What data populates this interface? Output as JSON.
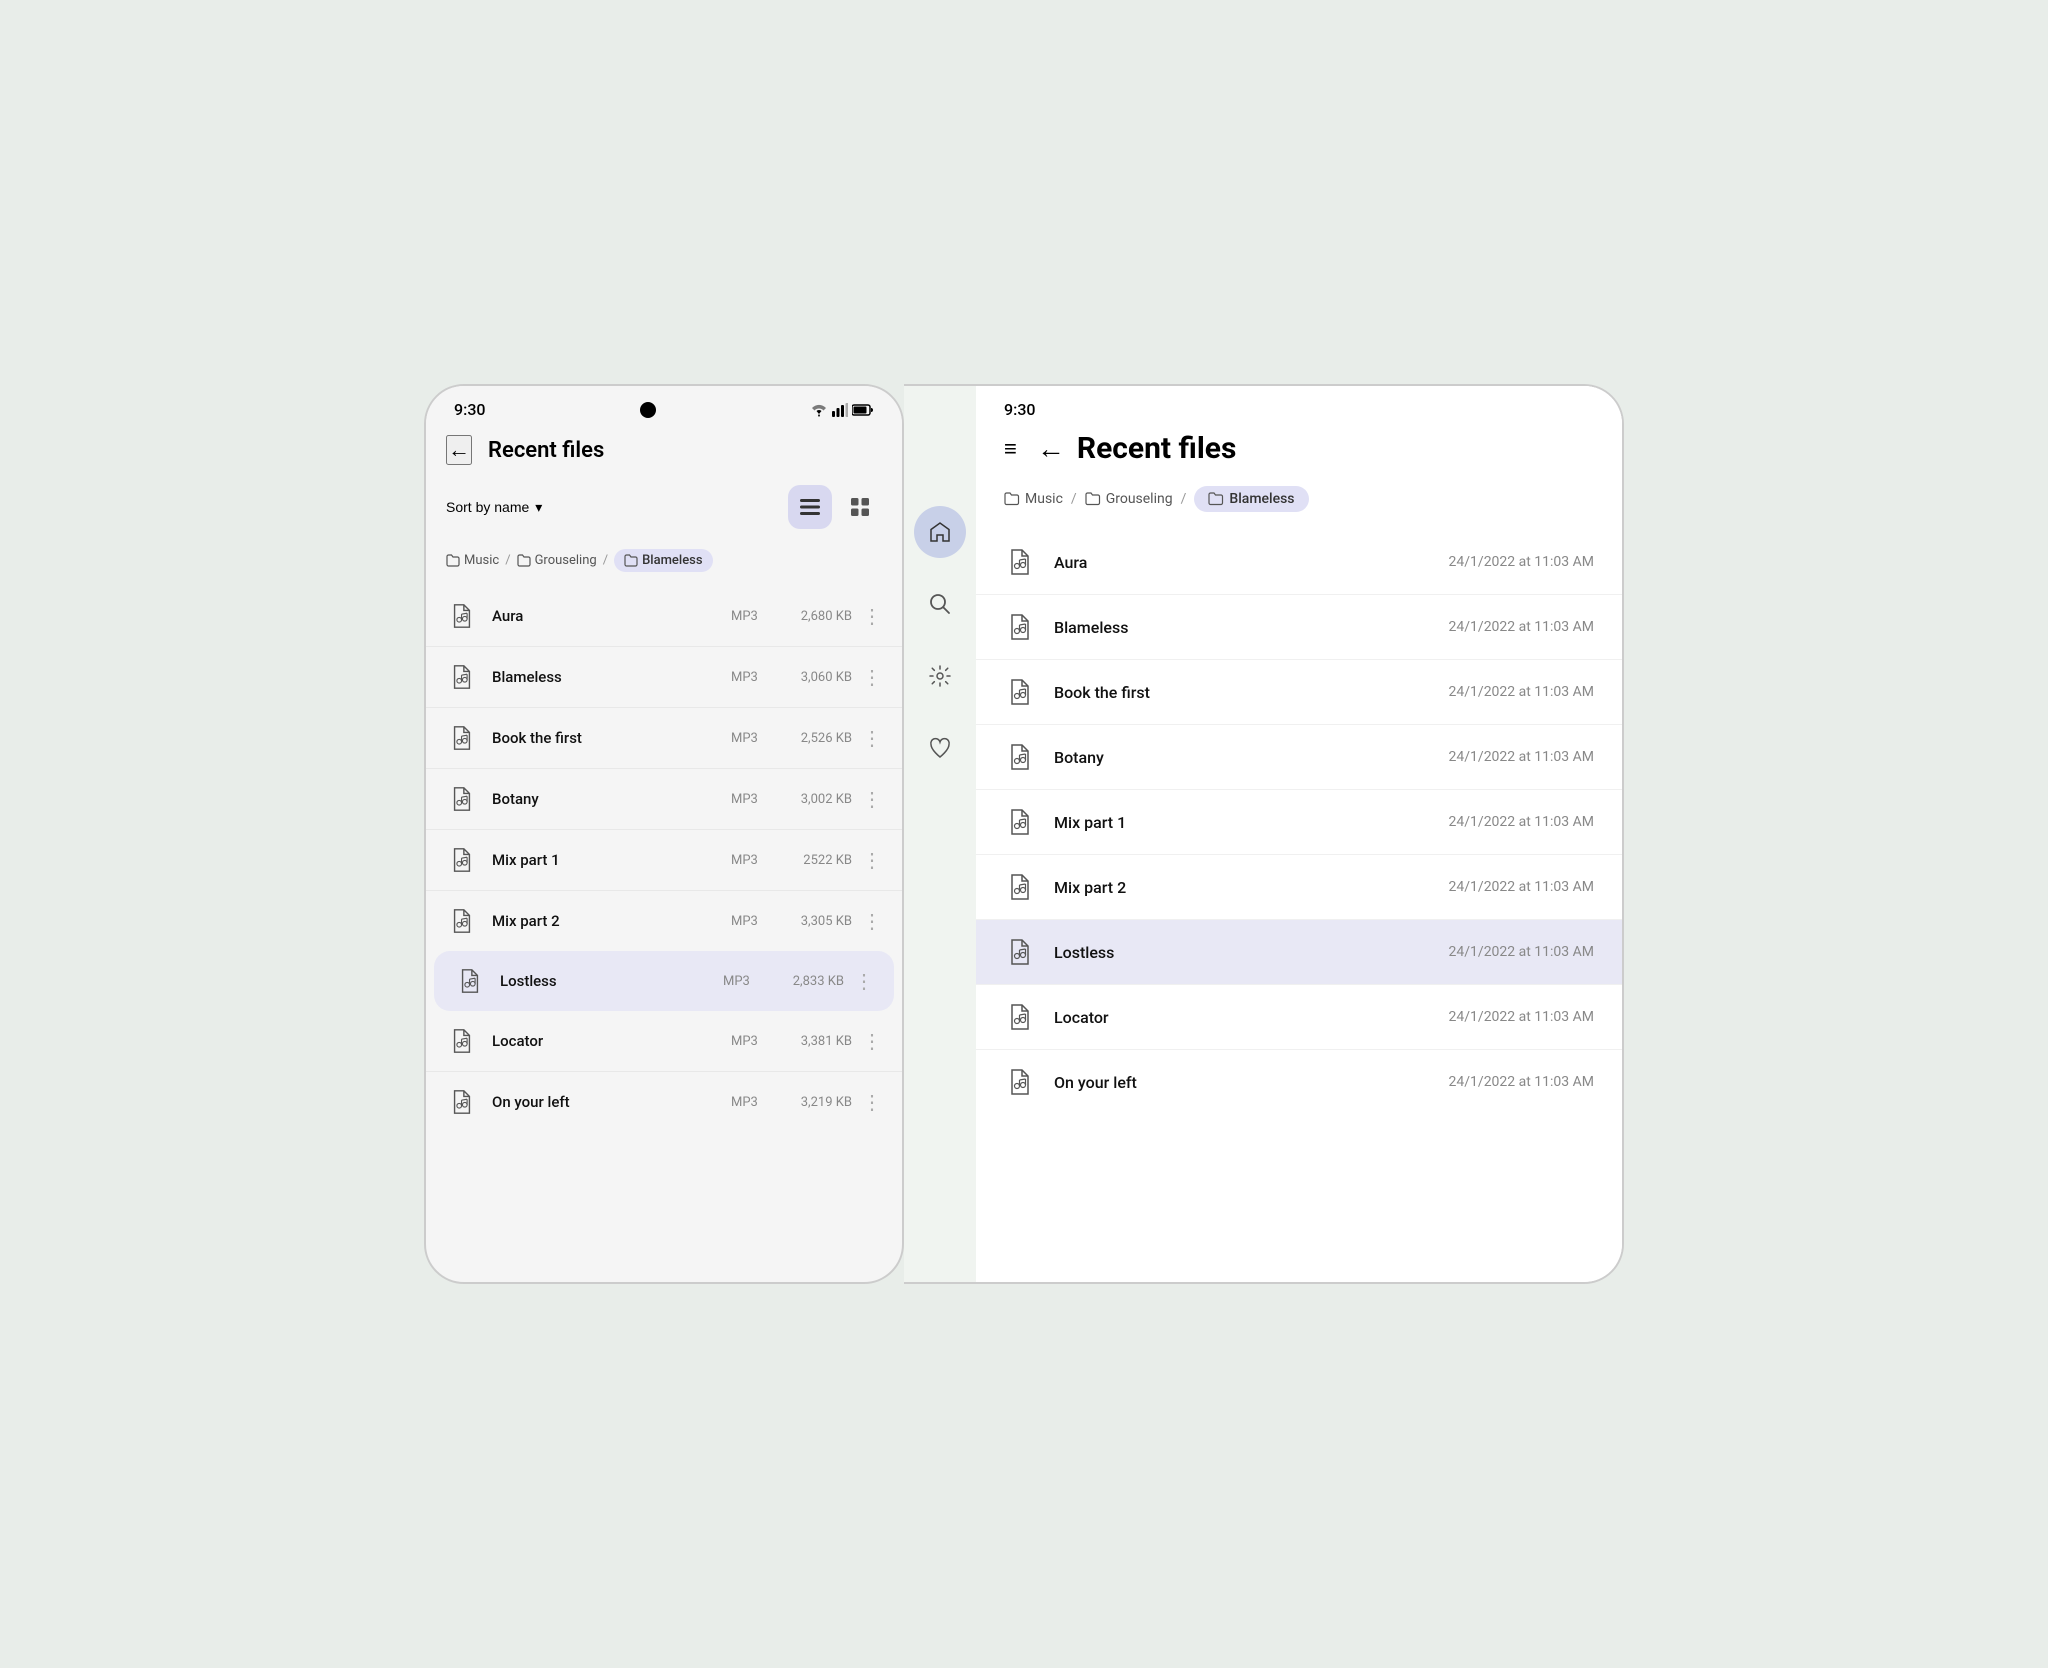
{
  "colors": {
    "background": "#e8ede9",
    "phone_bg": "#f5f5f5",
    "tablet_bg": "#ffffff",
    "sidebar_bg": "#f0f4f0",
    "active_nav": "#c8d0e8",
    "active_item": "#e8e8f5",
    "breadcrumb_active": "#e0e0f5",
    "accent": "#6060c0"
  },
  "phone_mobile": {
    "status": {
      "time": "9:30"
    },
    "header": {
      "back_label": "←",
      "title": "Recent files"
    },
    "toolbar": {
      "sort_label": "Sort by name",
      "sort_icon": "▾",
      "list_view_title": "List view",
      "grid_view_title": "Grid view"
    },
    "breadcrumb": [
      {
        "label": "Music",
        "active": false
      },
      {
        "label": "Grouseling",
        "active": false
      },
      {
        "label": "Blameless",
        "active": true
      }
    ],
    "files": [
      {
        "name": "Aura",
        "type": "MP3",
        "size": "2,680 KB",
        "selected": false
      },
      {
        "name": "Blameless",
        "type": "MP3",
        "size": "3,060 KB",
        "selected": false
      },
      {
        "name": "Book the first",
        "type": "MP3",
        "size": "2,526 KB",
        "selected": false
      },
      {
        "name": "Botany",
        "type": "MP3",
        "size": "3,002 KB",
        "selected": false
      },
      {
        "name": "Mix part 1",
        "type": "MP3",
        "size": "2522 KB",
        "selected": false
      },
      {
        "name": "Mix part 2",
        "type": "MP3",
        "size": "3,305 KB",
        "selected": false
      },
      {
        "name": "Lostless",
        "type": "MP3",
        "size": "2,833 KB",
        "selected": true
      },
      {
        "name": "Locator",
        "type": "MP3",
        "size": "3,381 KB",
        "selected": false
      },
      {
        "name": "On your left",
        "type": "MP3",
        "size": "3,219 KB",
        "selected": false
      }
    ]
  },
  "phone_tablet": {
    "status": {
      "time": "9:30"
    },
    "header": {
      "hamburger": "≡",
      "back_label": "←",
      "title": "Recent files"
    },
    "breadcrumb": [
      {
        "label": "Music",
        "active": false
      },
      {
        "label": "Grouseling",
        "active": false
      },
      {
        "label": "Blameless",
        "active": true
      }
    ],
    "sidebar": {
      "home_title": "Home",
      "search_title": "Search",
      "settings_title": "Settings",
      "favorites_title": "Favorites"
    },
    "files": [
      {
        "name": "Aura",
        "date": "24/1/2022 at 11:03 AM",
        "selected": false
      },
      {
        "name": "Blameless",
        "date": "24/1/2022 at 11:03 AM",
        "selected": false
      },
      {
        "name": "Book the first",
        "date": "24/1/2022 at 11:03 AM",
        "selected": false
      },
      {
        "name": "Botany",
        "date": "24/1/2022 at 11:03 AM",
        "selected": false
      },
      {
        "name": "Mix part 1",
        "date": "24/1/2022 at 11:03 AM",
        "selected": false
      },
      {
        "name": "Mix part 2",
        "date": "24/1/2022 at 11:03 AM",
        "selected": false
      },
      {
        "name": "Lostless",
        "date": "24/1/2022 at 11:03 AM",
        "selected": true
      },
      {
        "name": "Locator",
        "date": "24/1/2022 at 11:03 AM",
        "selected": false
      },
      {
        "name": "On your left",
        "date": "24/1/2022 at 11:03 AM",
        "selected": false
      }
    ]
  }
}
